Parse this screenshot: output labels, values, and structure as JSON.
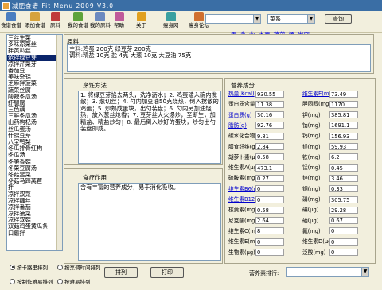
{
  "app_title": "减肥食谱 Fit Menu 2009 V3.0",
  "toolbar": [
    {
      "label": "食谱食谱",
      "color": "#4a7ec0"
    },
    {
      "label": "添加食谱",
      "color": "#d6a23b"
    },
    {
      "label": "原料",
      "color": "#c03a3a"
    },
    {
      "label": "我的食谱",
      "color": "#5ea33a"
    },
    {
      "label": "我的原料",
      "color": "#6b8ac0"
    },
    {
      "label": "帮助",
      "color": "#c05a9a"
    },
    {
      "label": "关于",
      "color": "#e0a020"
    },
    {
      "label": "瘦身网",
      "color": "#3aa0a0"
    },
    {
      "label": "瘦身论坛",
      "color": "#d07030"
    }
  ],
  "search": {
    "keyword": "",
    "category": "菜系",
    "query_label": "查询"
  },
  "categories": [
    "蛋",
    "禽",
    "肉",
    "水产",
    "蔬菜",
    "汤",
    "米面"
  ],
  "recipes": [
    "三丝生菜",
    "多味凉菜丝",
    "拌黄瓜丝",
    "炝拌绿豆芽",
    "凉拌芹菜芽",
    "番茄豆",
    "美味杂锦",
    "芝麻拌菠菜",
    "蔬菜丝腐",
    "酸辣冬瓜汤",
    "虾腿腐",
    "三色藕",
    "三鲜冬瓜汤",
    "山药枸杞汤",
    "丝瓜蛋汤",
    "什锦豆芽",
    "八宝鸭梨",
    "冬瓜排骨红枸",
    "冬瓜汤",
    "冬笋香菇",
    "冬菜豆腐汤",
    "冬菇韭菜",
    "冬菇马蹄莴苣",
    "拌",
    "凉拌双菜",
    "凉拌藕丝",
    "凉拌番茄",
    "凉拌菠菜",
    "凉拌双菇",
    "双菇鸡蛋黄瓜条",
    "口蘑拌"
  ],
  "selected_index": 3,
  "ingredients": {
    "header": "原料",
    "main": "主料:鸡蛋 200克 绿豆芽 200克",
    "seasoning": "调料:精盐 10克 盐 4克 大葱 10克 大豆油 75克"
  },
  "method": {
    "header": "烹饪方法",
    "text": "1. 将绿豆芽掐去两头，洗净沥水；2. 鸡蛋磕入碗内搅散；3. 葱切丝；4. 勺内加豆油50克烧热，倒入搅散的鸡蛋；5. 炒熟成蛋块，出勺装盘；6. 勺内另加油烧热，放入葱丝炝香；7. 豆芽丝大火爆炒，至断生，加精盐、精盐炒匀；8. 最后倒入炒好的蛋块，炒匀出勺装盘即成。"
  },
  "effect": {
    "header": "食疗作用",
    "text": "含有丰富的营养成分，易于消化吸收。"
  },
  "nutrition": {
    "header": "营养成分",
    "left": [
      {
        "label": "热量(Kcal)",
        "value": "930.55",
        "link": true
      },
      {
        "label": "蛋白质含量(g)",
        "value": "11.38",
        "link": false
      },
      {
        "label": "蛋白质(g)",
        "value": "30.16",
        "link": true
      },
      {
        "label": "脂肪(g)",
        "value": "92.76",
        "link": true
      },
      {
        "label": "碳水化合物(g)",
        "value": "9.81",
        "link": false
      },
      {
        "label": "膳食纤维(g)",
        "value": "2.84",
        "link": false
      },
      {
        "label": "胡萝卜素(μg)",
        "value": "0.58",
        "link": false
      },
      {
        "label": "维生素A(μg)",
        "value": "473.1",
        "link": false
      },
      {
        "label": "硫胺素(mg)",
        "value": "0.27",
        "link": false
      },
      {
        "label": "维生素B6(mg)",
        "value": "0",
        "link": true
      },
      {
        "label": "维生素B12(μg)",
        "value": "0",
        "link": true
      },
      {
        "label": "核黄素(mg)",
        "value": "0.58",
        "link": false
      },
      {
        "label": "尼克酸(mg)",
        "value": "2.64",
        "link": false
      },
      {
        "label": "维生素C(mg)",
        "value": "8",
        "link": false
      },
      {
        "label": "维生素E(mg)",
        "value": "0",
        "link": false
      },
      {
        "label": "生物素(μg)",
        "value": "0",
        "link": false
      }
    ],
    "right": [
      {
        "label": "维生素E(mg)",
        "value": "73.49",
        "link": true
      },
      {
        "label": "胆固醇(mg)",
        "value": "1170",
        "link": false
      },
      {
        "label": "钾(mg)",
        "value": "385.81",
        "link": false
      },
      {
        "label": "钠(mg)",
        "value": "1691.1",
        "link": false
      },
      {
        "label": "钙(mg)",
        "value": "156.93",
        "link": false
      },
      {
        "label": "镁(mg)",
        "value": "59.93",
        "link": false
      },
      {
        "label": "铁(mg)",
        "value": "6.2",
        "link": false
      },
      {
        "label": "锰(mg)",
        "value": "0.45",
        "link": false
      },
      {
        "label": "锌(mg)",
        "value": "3.46",
        "link": false
      },
      {
        "label": "铜(mg)",
        "value": "0.33",
        "link": false
      },
      {
        "label": "磷(mg)",
        "value": "305.75",
        "link": false
      },
      {
        "label": "碘(μg)",
        "value": "29.28",
        "link": false
      },
      {
        "label": "硒(μg)",
        "value": "0.67",
        "link": false
      },
      {
        "label": "氟(mg)",
        "value": "0",
        "link": false
      },
      {
        "label": "维生素D(μg)",
        "value": "0",
        "link": false
      },
      {
        "label": "泛酸(mg)",
        "value": "0",
        "link": false
      }
    ]
  },
  "sort": {
    "options": [
      "按卡路里排列",
      "按烹调时间排列",
      "按制作难易排列",
      "按难易排列"
    ],
    "selected": 0,
    "sort_button": "排列",
    "print_button": "打印"
  },
  "nutrient_sort": {
    "label": "营养素排行:",
    "value": ""
  }
}
